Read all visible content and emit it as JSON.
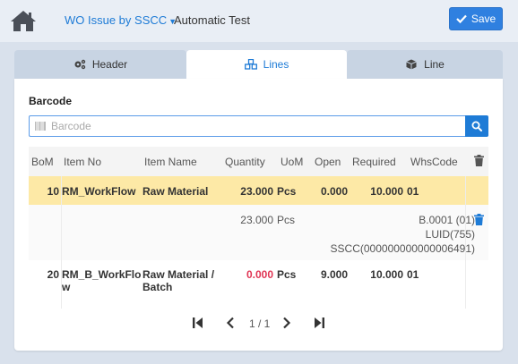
{
  "header": {
    "wo_link": "WO Issue by SSCC",
    "subtitle": "Automatic Test",
    "save_label": "Save"
  },
  "tabs": [
    {
      "label": "Header",
      "icon": "gears-icon",
      "active": false
    },
    {
      "label": "Lines",
      "icon": "cubes-icon",
      "active": true
    },
    {
      "label": "Line",
      "icon": "cube-icon",
      "active": false
    }
  ],
  "barcode": {
    "label": "Barcode",
    "placeholder": "Barcode"
  },
  "table": {
    "columns": [
      "BoM",
      "Item No",
      "Item Name",
      "Quantity",
      "UoM",
      "Open",
      "Required",
      "WhsCode"
    ],
    "rows": [
      {
        "bom": "10",
        "item_no": "RM_WorkFlow",
        "item_name": "Raw Material",
        "quantity": "23.000",
        "uom": "Pcs",
        "open": "0.000",
        "required": "10.000",
        "whs": "01",
        "highlight": "#fde9a6"
      },
      {
        "quantity": "23.000",
        "uom": "Pcs",
        "batch": "B.0001 (01)",
        "luid": "LUID(755)",
        "sscc": "SSCC(000000000000006491)"
      },
      {
        "bom": "20",
        "item_no_1": "RM_B_WorkFlo",
        "item_no_2": "w",
        "item_name_1": "Raw Material /",
        "item_name_2": "Batch",
        "quantity": "0.000",
        "uom": "Pcs",
        "open": "9.000",
        "required": "10.000",
        "whs": "01",
        "quantity_color": "#e03554"
      }
    ]
  },
  "pager": {
    "text": "1 / 1"
  },
  "colors": {
    "accent": "#1e7bd6",
    "highlight_row": "#fde9a6",
    "warning_text": "#e03554"
  }
}
